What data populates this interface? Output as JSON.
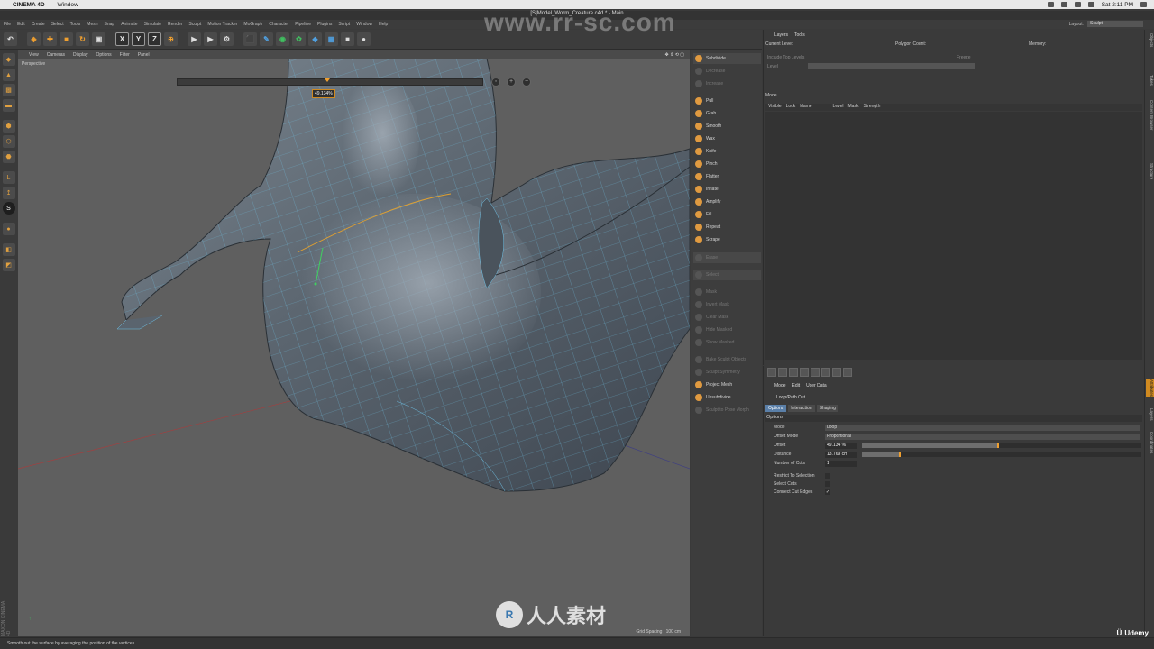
{
  "mac_bar": {
    "app_name": "CINEMA 4D",
    "menus": [
      "Window"
    ],
    "clock": "Sat 2:11 PM"
  },
  "window_title": "[S]Model_Worm_Creature.c4d * - Main",
  "watermark": "www.rr-sc.com",
  "c4d_menu": [
    "File",
    "Edit",
    "Create",
    "Select",
    "Tools",
    "Mesh",
    "Snap",
    "Animate",
    "Simulate",
    "Render",
    "Sculpt",
    "Motion Tracker",
    "MoGraph",
    "Character",
    "Pipeline",
    "Plugins",
    "Script",
    "Window",
    "Help"
  ],
  "layout": {
    "label": "Layout:",
    "value": "Sculpt"
  },
  "toolbar": [
    "undo-icon",
    "live-selection-icon",
    "move-icon",
    "scale-icon",
    "rotate-icon",
    "recent-tools-icon",
    "x-axis-lock-icon",
    "y-axis-lock-icon",
    "z-axis-lock-icon",
    "coordinate-system-icon",
    "render-view-icon",
    "render-picture-viewer-icon",
    "edit-render-settings-icon",
    "cube-icon",
    "pen-icon",
    "subdivision-icon",
    "array-icon",
    "deformer-icon",
    "floor-icon",
    "camera-icon",
    "light-icon"
  ],
  "viewport": {
    "menus": [
      "View",
      "Cameras",
      "Display",
      "Options",
      "Filter",
      "Panel"
    ],
    "camera_label": "Perspective",
    "offset_tooltip": "49.134%",
    "grid_spacing": "Grid Spacing : 100 cm"
  },
  "sculpt": {
    "top": [
      {
        "label": "Subdivide",
        "enabled": true
      },
      {
        "label": "Decrease",
        "enabled": false
      },
      {
        "label": "Increase",
        "enabled": false
      }
    ],
    "brushes": [
      "Pull",
      "Grab",
      "Smooth",
      "Wax",
      "Knife",
      "Pinch",
      "Flatten",
      "Inflate",
      "Amplify",
      "Fill",
      "Repeat",
      "Scrape"
    ],
    "disabled_tools": [
      "Erase",
      "Select",
      "Mask",
      "Invert Mask",
      "Clear Mask",
      "Hide Masked",
      "Show Masked",
      "Bake Sculpt Objects",
      "Sculpt Symmetry"
    ],
    "bottom": [
      "Project Mesh",
      "Unsubdivide"
    ],
    "last_disabled": "Sculpt to Pose Morph"
  },
  "layers": {
    "tabs": [
      "Layers",
      "Tools"
    ],
    "current_level_label": "Current Level:",
    "polygon_count_label": "Polygon Count:",
    "memory_label": "Memory:",
    "include_top_levels": "Include Top Levels",
    "freeze": "Freeze",
    "level_label": "Level",
    "mode_label": "Mode",
    "columns": [
      "Visible",
      "Lock",
      "Name",
      "Level",
      "Mask",
      "Strength"
    ]
  },
  "attributes": {
    "menu": [
      "Mode",
      "Edit",
      "User Data"
    ],
    "tool_name": "Loop/Path Cut",
    "tabs": [
      "Options",
      "Interaction",
      "Shaping"
    ],
    "section": "Options",
    "mode_label": "Mode",
    "mode_value": "Loop",
    "offset_mode_label": "Offset Mode",
    "offset_mode_value": "Proportional",
    "offset_label": "Offset",
    "offset_value": "49.134 %",
    "offset_fraction": 0.49134,
    "distance_label": "Distance",
    "distance_value": "13.769 cm",
    "distance_fraction": 0.14,
    "cuts_label": "Number of Cuts",
    "cuts_value": "1",
    "restrict_label": "Restrict To Selection",
    "restrict_checked": false,
    "select_cuts_label": "Select Cuts",
    "select_cuts_checked": false,
    "connect_label": "Connect Cut Edges",
    "connect_checked": true,
    "check_mark": "✓"
  },
  "right_strip": [
    "Objects",
    "Takes",
    "Content Browser",
    "Structure",
    "Attributes",
    "Layers",
    "Coordinates"
  ],
  "status_text": "Smooth out the surface by averaging the position of the vertices",
  "brand_logo_text": "人人素材",
  "udemy": "Udemy",
  "maxon": "MAXON CINEMA 4D",
  "colors": {
    "accent": "#f0a030",
    "wire": "#6fc3e8",
    "mesh": "#55606a",
    "viewport_bg": "#5f5f5f"
  }
}
